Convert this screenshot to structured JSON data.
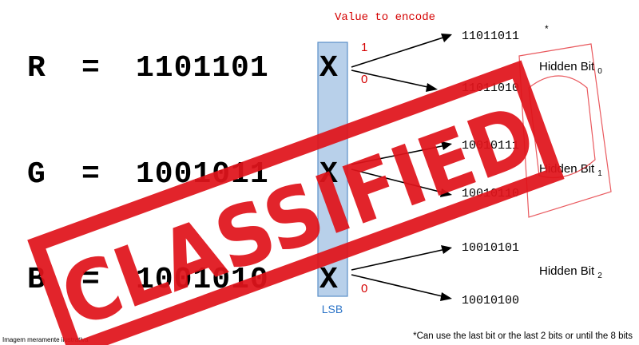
{
  "title": "Value to encode",
  "lsb_label": "LSB",
  "footnote": "*Can use the last bit or the last 2 bits or until the 8 bits",
  "caption": "Imagem meramente ilustrativa",
  "stamp_text": "CLASSIFIED",
  "channels": [
    {
      "label": "R",
      "equals": "=",
      "bits": "1101101",
      "var": "X",
      "branch_one": "1",
      "branch_zero": "0",
      "out_one": "11011011",
      "out_one_mark": "*",
      "out_zero": "11011010",
      "hidden_base": "Hidden Bit",
      "hidden_sub": "0"
    },
    {
      "label": "G",
      "equals": "=",
      "bits": "1001011",
      "var": "X",
      "branch_one": "",
      "branch_zero": "",
      "out_one": "10010111",
      "out_one_mark": "",
      "out_zero": "10010110",
      "hidden_base": "Hidden Bit",
      "hidden_sub": "1"
    },
    {
      "label": "B",
      "equals": "=",
      "bits": "1001010",
      "var": "X",
      "branch_one": "",
      "branch_zero": "0",
      "out_one": "10010101",
      "out_one_mark": "",
      "out_zero": "10010100",
      "hidden_base": "Hidden Bit",
      "hidden_sub": "2"
    }
  ],
  "colors": {
    "accent_red": "#d40000",
    "lsb_fill": "#b8d0ea",
    "lsb_stroke": "#5b8fc9",
    "lsb_text": "#2e75c8",
    "stamp_red": "#e0141b",
    "ink": "#000000"
  }
}
